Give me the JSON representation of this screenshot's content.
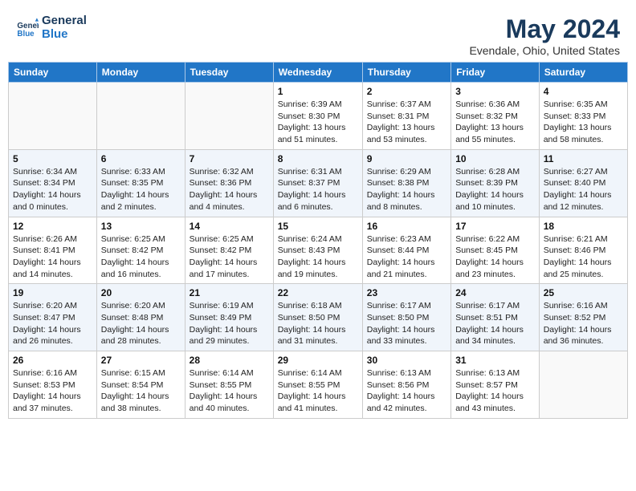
{
  "header": {
    "logo_line1": "General",
    "logo_line2": "Blue",
    "month_title": "May 2024",
    "location": "Evendale, Ohio, United States"
  },
  "weekdays": [
    "Sunday",
    "Monday",
    "Tuesday",
    "Wednesday",
    "Thursday",
    "Friday",
    "Saturday"
  ],
  "weeks": [
    [
      {
        "day": "",
        "sunrise": "",
        "sunset": "",
        "daylight": ""
      },
      {
        "day": "",
        "sunrise": "",
        "sunset": "",
        "daylight": ""
      },
      {
        "day": "",
        "sunrise": "",
        "sunset": "",
        "daylight": ""
      },
      {
        "day": "1",
        "sunrise": "Sunrise: 6:39 AM",
        "sunset": "Sunset: 8:30 PM",
        "daylight": "Daylight: 13 hours and 51 minutes."
      },
      {
        "day": "2",
        "sunrise": "Sunrise: 6:37 AM",
        "sunset": "Sunset: 8:31 PM",
        "daylight": "Daylight: 13 hours and 53 minutes."
      },
      {
        "day": "3",
        "sunrise": "Sunrise: 6:36 AM",
        "sunset": "Sunset: 8:32 PM",
        "daylight": "Daylight: 13 hours and 55 minutes."
      },
      {
        "day": "4",
        "sunrise": "Sunrise: 6:35 AM",
        "sunset": "Sunset: 8:33 PM",
        "daylight": "Daylight: 13 hours and 58 minutes."
      }
    ],
    [
      {
        "day": "5",
        "sunrise": "Sunrise: 6:34 AM",
        "sunset": "Sunset: 8:34 PM",
        "daylight": "Daylight: 14 hours and 0 minutes."
      },
      {
        "day": "6",
        "sunrise": "Sunrise: 6:33 AM",
        "sunset": "Sunset: 8:35 PM",
        "daylight": "Daylight: 14 hours and 2 minutes."
      },
      {
        "day": "7",
        "sunrise": "Sunrise: 6:32 AM",
        "sunset": "Sunset: 8:36 PM",
        "daylight": "Daylight: 14 hours and 4 minutes."
      },
      {
        "day": "8",
        "sunrise": "Sunrise: 6:31 AM",
        "sunset": "Sunset: 8:37 PM",
        "daylight": "Daylight: 14 hours and 6 minutes."
      },
      {
        "day": "9",
        "sunrise": "Sunrise: 6:29 AM",
        "sunset": "Sunset: 8:38 PM",
        "daylight": "Daylight: 14 hours and 8 minutes."
      },
      {
        "day": "10",
        "sunrise": "Sunrise: 6:28 AM",
        "sunset": "Sunset: 8:39 PM",
        "daylight": "Daylight: 14 hours and 10 minutes."
      },
      {
        "day": "11",
        "sunrise": "Sunrise: 6:27 AM",
        "sunset": "Sunset: 8:40 PM",
        "daylight": "Daylight: 14 hours and 12 minutes."
      }
    ],
    [
      {
        "day": "12",
        "sunrise": "Sunrise: 6:26 AM",
        "sunset": "Sunset: 8:41 PM",
        "daylight": "Daylight: 14 hours and 14 minutes."
      },
      {
        "day": "13",
        "sunrise": "Sunrise: 6:25 AM",
        "sunset": "Sunset: 8:42 PM",
        "daylight": "Daylight: 14 hours and 16 minutes."
      },
      {
        "day": "14",
        "sunrise": "Sunrise: 6:25 AM",
        "sunset": "Sunset: 8:42 PM",
        "daylight": "Daylight: 14 hours and 17 minutes."
      },
      {
        "day": "15",
        "sunrise": "Sunrise: 6:24 AM",
        "sunset": "Sunset: 8:43 PM",
        "daylight": "Daylight: 14 hours and 19 minutes."
      },
      {
        "day": "16",
        "sunrise": "Sunrise: 6:23 AM",
        "sunset": "Sunset: 8:44 PM",
        "daylight": "Daylight: 14 hours and 21 minutes."
      },
      {
        "day": "17",
        "sunrise": "Sunrise: 6:22 AM",
        "sunset": "Sunset: 8:45 PM",
        "daylight": "Daylight: 14 hours and 23 minutes."
      },
      {
        "day": "18",
        "sunrise": "Sunrise: 6:21 AM",
        "sunset": "Sunset: 8:46 PM",
        "daylight": "Daylight: 14 hours and 25 minutes."
      }
    ],
    [
      {
        "day": "19",
        "sunrise": "Sunrise: 6:20 AM",
        "sunset": "Sunset: 8:47 PM",
        "daylight": "Daylight: 14 hours and 26 minutes."
      },
      {
        "day": "20",
        "sunrise": "Sunrise: 6:20 AM",
        "sunset": "Sunset: 8:48 PM",
        "daylight": "Daylight: 14 hours and 28 minutes."
      },
      {
        "day": "21",
        "sunrise": "Sunrise: 6:19 AM",
        "sunset": "Sunset: 8:49 PM",
        "daylight": "Daylight: 14 hours and 29 minutes."
      },
      {
        "day": "22",
        "sunrise": "Sunrise: 6:18 AM",
        "sunset": "Sunset: 8:50 PM",
        "daylight": "Daylight: 14 hours and 31 minutes."
      },
      {
        "day": "23",
        "sunrise": "Sunrise: 6:17 AM",
        "sunset": "Sunset: 8:50 PM",
        "daylight": "Daylight: 14 hours and 33 minutes."
      },
      {
        "day": "24",
        "sunrise": "Sunrise: 6:17 AM",
        "sunset": "Sunset: 8:51 PM",
        "daylight": "Daylight: 14 hours and 34 minutes."
      },
      {
        "day": "25",
        "sunrise": "Sunrise: 6:16 AM",
        "sunset": "Sunset: 8:52 PM",
        "daylight": "Daylight: 14 hours and 36 minutes."
      }
    ],
    [
      {
        "day": "26",
        "sunrise": "Sunrise: 6:16 AM",
        "sunset": "Sunset: 8:53 PM",
        "daylight": "Daylight: 14 hours and 37 minutes."
      },
      {
        "day": "27",
        "sunrise": "Sunrise: 6:15 AM",
        "sunset": "Sunset: 8:54 PM",
        "daylight": "Daylight: 14 hours and 38 minutes."
      },
      {
        "day": "28",
        "sunrise": "Sunrise: 6:14 AM",
        "sunset": "Sunset: 8:55 PM",
        "daylight": "Daylight: 14 hours and 40 minutes."
      },
      {
        "day": "29",
        "sunrise": "Sunrise: 6:14 AM",
        "sunset": "Sunset: 8:55 PM",
        "daylight": "Daylight: 14 hours and 41 minutes."
      },
      {
        "day": "30",
        "sunrise": "Sunrise: 6:13 AM",
        "sunset": "Sunset: 8:56 PM",
        "daylight": "Daylight: 14 hours and 42 minutes."
      },
      {
        "day": "31",
        "sunrise": "Sunrise: 6:13 AM",
        "sunset": "Sunset: 8:57 PM",
        "daylight": "Daylight: 14 hours and 43 minutes."
      },
      {
        "day": "",
        "sunrise": "",
        "sunset": "",
        "daylight": ""
      }
    ]
  ]
}
